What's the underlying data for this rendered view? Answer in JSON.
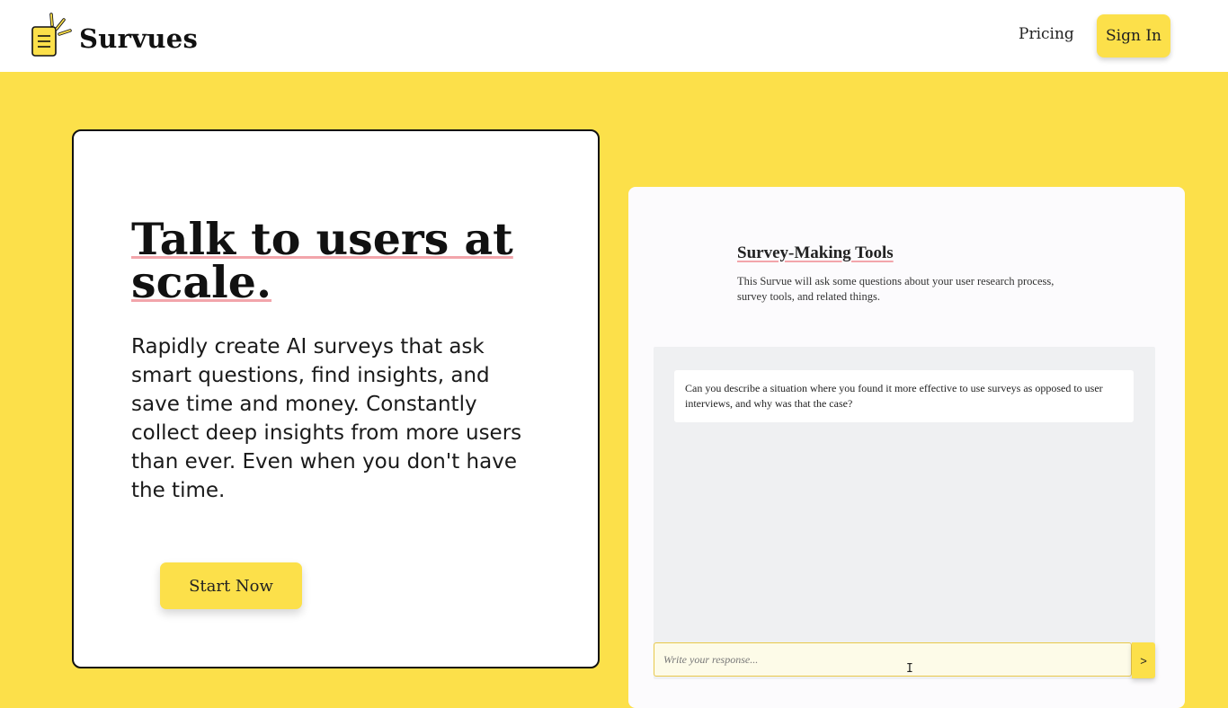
{
  "header": {
    "brand": "Survues",
    "nav": {
      "pricing_label": "Pricing",
      "signin_label": "Sign In"
    },
    "logo_icon": "notepad-with-sparkle-icon"
  },
  "hero": {
    "title_line1": "Talk to users at",
    "title_line2": "scale.",
    "description": "Rapidly create AI surveys that ask smart questions, find insights, and save time and money. Constantly collect deep insights from more users than ever. Even when you don't have the time.",
    "cta_label": "Start Now"
  },
  "preview": {
    "survey_title": "Survey-Making Tools",
    "survey_description": "This Survue will ask some questions about your user research process, survey tools, and related things.",
    "question": "Can you describe a situation where you found it more effective to use surveys as opposed to user interviews, and why was that the case?",
    "response_placeholder": "Write your response...",
    "send_label": ">"
  },
  "colors": {
    "brand_yellow": "#fce04a",
    "underline_pink": "#f2a5ab",
    "chat_bg": "#eff0f2"
  }
}
